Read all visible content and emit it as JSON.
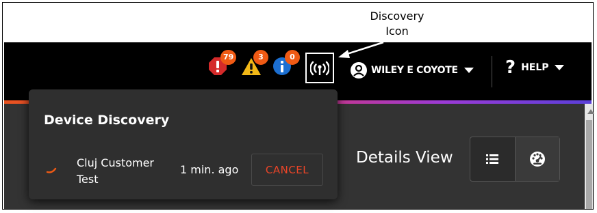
{
  "annotation": {
    "callout_lines": [
      "Discovery",
      "Icon"
    ]
  },
  "header": {
    "alerts": [
      {
        "name": "critical",
        "icon": "octagon-alert-icon",
        "count": "79",
        "color": "#d42a2a"
      },
      {
        "name": "warning",
        "icon": "triangle-warning-icon",
        "count": "3",
        "color": "#f2b817"
      },
      {
        "name": "info",
        "icon": "info-circle-icon",
        "count": "0",
        "color": "#1c6fd1"
      }
    ],
    "discovery_icon": "broadcast-antenna-icon",
    "user": {
      "icon": "user-circle-icon",
      "name": "WILEY E COYOTE"
    },
    "help": {
      "icon": "question-mark-icon",
      "label": "HELP"
    }
  },
  "popup": {
    "title": "Device Discovery",
    "items": [
      {
        "name_lines": [
          "Cluj Customer",
          "Test"
        ],
        "time": "1 min. ago",
        "action": "CANCEL"
      }
    ]
  },
  "main": {
    "title": "Details View",
    "view_buttons": [
      {
        "icon": "list-view-icon"
      },
      {
        "icon": "dashboard-gauge-icon"
      }
    ]
  },
  "colors": {
    "accent": "#f05a14",
    "gradient": [
      "#e8531f",
      "#d9366c",
      "#9b3bd6",
      "#5a3fd8"
    ],
    "cancel": "#ec4528"
  }
}
